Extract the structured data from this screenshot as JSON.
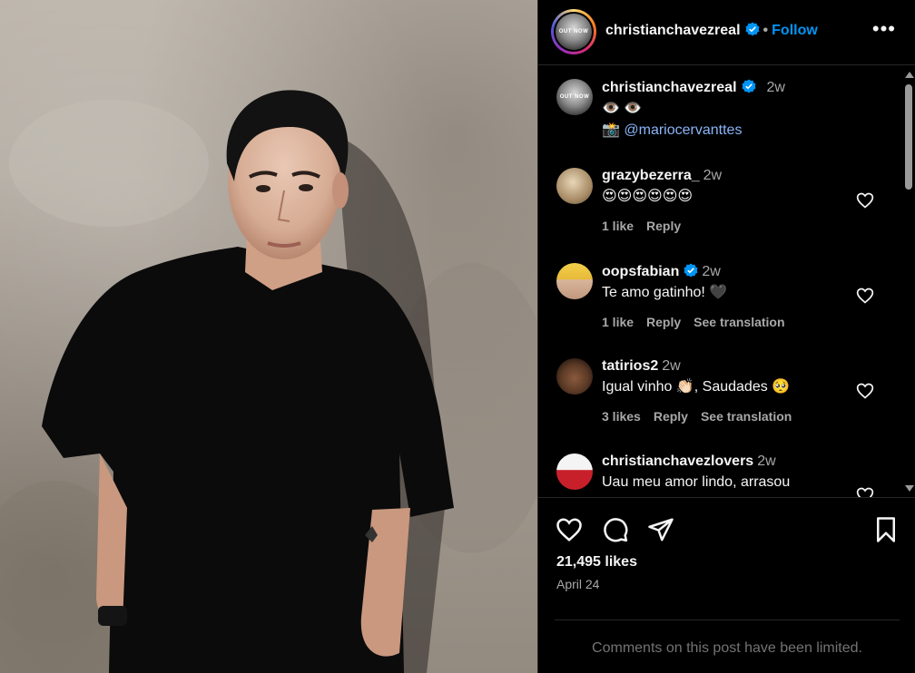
{
  "post": {
    "username": "christianchavezreal",
    "verified": true,
    "follow_label": "Follow",
    "separator": "•",
    "more_label": "•••"
  },
  "caption": {
    "username": "christianchavezreal",
    "time": "2w",
    "line1": "👁️ 👁️",
    "camera": "📸",
    "mention": "@mariocervanttes"
  },
  "comments": [
    {
      "username": "grazybezerra_",
      "time": "2w",
      "verified": false,
      "text": "😍😍😍😍😍😍",
      "likes": "1 like",
      "reply": "Reply",
      "translate": ""
    },
    {
      "username": "oopsfabian",
      "time": "2w",
      "verified": true,
      "text": "Te amo gatinho! 🖤",
      "likes": "1 like",
      "reply": "Reply",
      "translate": "See translation"
    },
    {
      "username": "tatirios2",
      "time": "2w",
      "verified": false,
      "text": "Igual vinho 👏🏻, Saudades 🥺",
      "likes": "3 likes",
      "reply": "Reply",
      "translate": "See translation"
    },
    {
      "username": "christianchavezlovers",
      "time": "2w",
      "verified": false,
      "text": "Uau meu amor lindo, arrasou",
      "likes": "",
      "reply": "",
      "translate": ""
    }
  ],
  "footer": {
    "likes": "21,495 likes",
    "date": "April 24",
    "limited": "Comments on this post have been limited."
  },
  "colors": {
    "accent": "#0095f6",
    "background": "#000000",
    "muted": "#a8a8a8",
    "border": "#262626"
  }
}
